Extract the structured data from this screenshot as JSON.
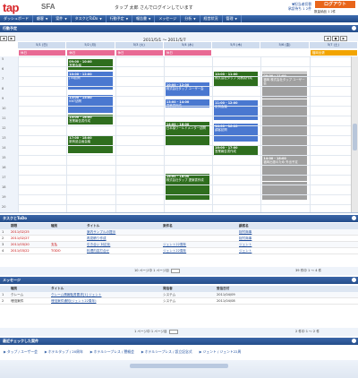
{
  "header": {
    "logo": "tap",
    "product": "SFA",
    "welcome": "タップ 太郎 さんでログインしています",
    "link1": "▼担当者切替",
    "link2": "承認待ち 1 2件",
    "logout": "ログアウト",
    "info": "数量納品 1 2件"
  },
  "menu": [
    {
      "label": "ダッシュボード"
    },
    {
      "label": "顧客",
      "dropdown": true
    },
    {
      "label": "案件",
      "dropdown": true
    },
    {
      "label": "タスクとToDo",
      "dropdown": true
    },
    {
      "label": "行動予定",
      "dropdown": true
    },
    {
      "label": "報告書",
      "dropdown": true
    },
    {
      "label": "メッセージ"
    },
    {
      "label": "分析",
      "dropdown": true
    },
    {
      "label": "経営状況"
    },
    {
      "label": "管理",
      "dropdown": true
    }
  ],
  "calendar": {
    "title": "行動予定",
    "range": "2011/5/1 ～ 2011/5/7",
    "nav_prev": "◀",
    "nav_today": "本日",
    "nav_next": "▶",
    "days": [
      "5/1 (日)",
      "5/2 (月)",
      "5/3 (火)",
      "5/4 (水)",
      "5/5 (木)",
      "5/6 (金)",
      "5/7 (土)"
    ],
    "allday": [
      {
        "label": "休日",
        "color": "#e86a94"
      },
      {
        "label": "休日",
        "color": "#e86a94"
      },
      {
        "label": "休日",
        "color": "#e86a94"
      },
      {
        "label": "休日",
        "color": "#e86a94"
      },
      {
        "label": "福岡出張",
        "color": "#f2a400"
      }
    ],
    "hours": [
      "5",
      "6",
      "7",
      "8",
      "9",
      "10",
      "11",
      "12",
      "13",
      "14",
      "15",
      "16",
      "17",
      "18",
      "19",
      "20"
    ],
    "events": [
      {
        "time": "09:00 - 10:00",
        "title": "営業会議",
        "color": "#2f6e1e"
      },
      {
        "time": "10:00 - 12:00",
        "title": "JTB訪問",
        "color": "#4a78d0"
      },
      {
        "time": "13:00 - 15:00",
        "title": "KNT訪問",
        "color": "#4a78d0"
      },
      {
        "time": "15:00 - 16:00",
        "title": "営業報告書作成",
        "color": "#2f6e1e"
      },
      {
        "time": "17:00 - 18:00",
        "title": "新商品企画会議",
        "color": "#2f6e1e"
      },
      {
        "time": "10:00 - 12:00",
        "title": "株式会社タップ ユーザー会",
        "color": "#4a78d0"
      },
      {
        "time": "13:00 - 14:00",
        "title": "見積書作成",
        "color": "#4a78d0"
      },
      {
        "time": "14:00 - 16:00",
        "title": "日本橋ワールドメンター訪問",
        "color": "#2f6e1e"
      },
      {
        "time": "16:00 - 18:00",
        "title": "株式会社タップ 提案書作成",
        "color": "#2f6e1e"
      },
      {
        "time": "10:00 - 11:00",
        "title": "株式会社タップ 見積書作成",
        "color": "#2f6e1e"
      },
      {
        "time": "11:00 - 12:00",
        "title": "定例会議",
        "color": "#4a78d0"
      },
      {
        "time": "14:00 - 16:00",
        "title": "顧客訪問",
        "color": "#4a78d0"
      },
      {
        "time": "16:00 - 17:00",
        "title": "営業報告書作成",
        "color": "#2f6e1e"
      },
      {
        "time": "09:00 - 20:00",
        "title": "福岡出張のため 外出予定",
        "color": "#a0a0a0"
      },
      {
        "time": "09:00 - 11:00",
        "title": "福岡 株式会社タップ ユーザー会",
        "color": "#a0a0a0"
      },
      {
        "time": "14:00 - 18:00",
        "title": "福岡出張のため 外出予定",
        "color": "#a0a0a0"
      }
    ]
  },
  "tasks": {
    "title": "タスクとToDo",
    "headers": [
      "期限",
      "種別",
      "タイトル",
      "案件名",
      "顧客名"
    ],
    "rows": [
      {
        "no": "1",
        "date": "2011/02/25",
        "type": "",
        "title": "案内サンプルの提示",
        "deal": "",
        "customer": "桜村商事"
      },
      {
        "no": "2",
        "date": "2011/02/27",
        "type": "",
        "title": "再見積り作成",
        "deal": "",
        "customer": "桜村商事"
      },
      {
        "no": "3",
        "date": "2011/03/20",
        "type": "支払",
        "title": "引き合い 対応化",
        "deal": "ジェント22周年",
        "customer": "ジェント"
      },
      {
        "no": "4",
        "date": "2011/03/22",
        "type": "TODO",
        "title": "料理内容打合せ",
        "deal": "ジェント22周年",
        "customer": "ジェント"
      }
    ],
    "pager": "10 ページ中 1 ページ目",
    "count": "39 件中 1 ～ 4 件"
  },
  "messages": {
    "title": "メッセージ",
    "headers": [
      "種別",
      "タイトル",
      "発信者",
      "受信日付"
    ],
    "rows": [
      {
        "no": "1",
        "type": "クレーム",
        "title": "クレーム情報転書要求[1] ジェント",
        "sender": "システム",
        "date": "2011/04/09"
      },
      {
        "no": "2",
        "type": "埋没案件",
        "title": "埋没案件通知(ジェント22周年)",
        "sender": "システム",
        "date": "2011/04/08"
      }
    ],
    "pager": "1 ページ中 1 ページ目",
    "count": "2 件中 1 ～ 2 件"
  },
  "recent": {
    "title": "最近チェックした案件",
    "items": [
      "タップ / ユーザー会",
      "ホテルタップ / 20周年",
      "ホテルシープレス / 懇親会",
      "ホテルシープレス / 設立記念式",
      "ジェント / ジェント22周"
    ]
  },
  "colors": {
    "accent": "#244d8b",
    "logo": "#d8262a",
    "logout": "#e8651a",
    "event_green": "#2f6e1e",
    "event_blue": "#4a78d0",
    "event_gray": "#a0a0a0"
  }
}
